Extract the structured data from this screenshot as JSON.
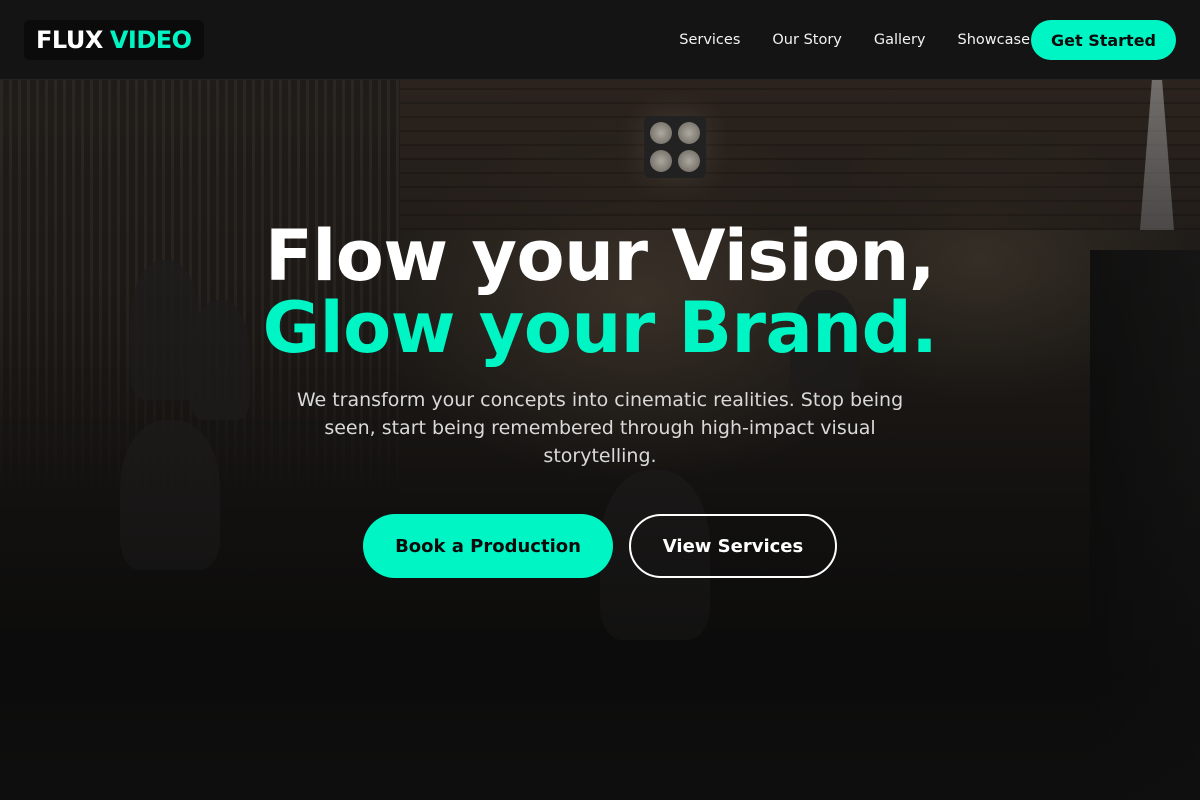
{
  "theme": {
    "accent": "#00f5c4",
    "background": "#121212",
    "text": "#ffffff"
  },
  "header": {
    "logo": {
      "part1": "FLUX",
      "part2": "VIDEO"
    },
    "nav": [
      "Services",
      "Our Story",
      "Gallery",
      "Showcase"
    ],
    "cta_label": "Get Started"
  },
  "hero": {
    "headline_line1": "Flow your Vision,",
    "headline_line2": "Glow your Brand.",
    "subtitle": "We transform your concepts into cinematic realities. Stop being seen, start being remembered through high-impact visual storytelling.",
    "primary_button": "Book a Production",
    "secondary_button": "View Services"
  }
}
